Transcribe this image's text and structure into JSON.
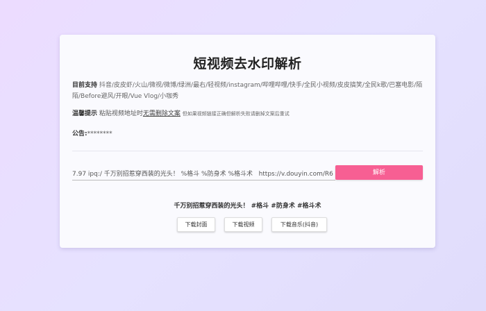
{
  "page": {
    "title": "短视频去水印解析"
  },
  "support": {
    "label": "目前支持",
    "text": "抖音/皮皮虾/火山/微视/微博/绿洲/最右/轻视频/instagram/哔哩哔哩/快手/全民小视频/皮皮搞笑/全民k歌/巴塞电影/陌陌/Before避风/开眼/Vue Vlog/小咖秀"
  },
  "tips": {
    "label": "温馨提示",
    "text_before": "粘贴视频地址时",
    "emphasis": "无需删除文案",
    "small": "但如果视频链接正确但解析失败请删掉文案后重试"
  },
  "notice": {
    "label": "公告:",
    "text": "********"
  },
  "form": {
    "url_value": "7.97 ipq:/ 千万别招惹穿西装的光头！ %格斗 %防身术 %格斗术   https://v.douyin.com/R6",
    "parse_label": "解析"
  },
  "result": {
    "title": "千万别招惹穿西装的光头！ #格斗 #防身术 #格斗术",
    "download_cover": "下载封面",
    "download_video": "下载视频",
    "download_music": "下载音乐(抖音)"
  },
  "colors": {
    "accent": "#f75f93",
    "background": "#e6e2ff"
  }
}
